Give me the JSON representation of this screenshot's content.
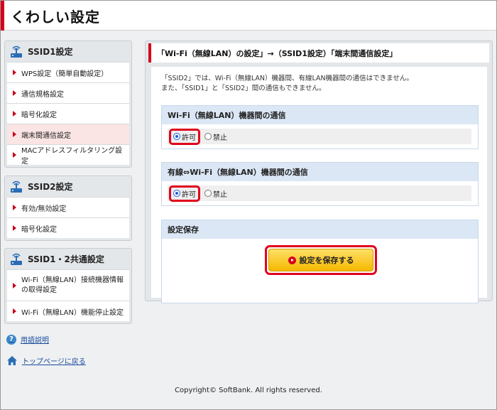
{
  "header": {
    "title": "くわしい設定"
  },
  "sidebar": {
    "groups": [
      {
        "title": "SSID1設定",
        "items": [
          {
            "label": "WPS設定（簡単自動設定）"
          },
          {
            "label": "通信規格設定"
          },
          {
            "label": "暗号化設定"
          },
          {
            "label": "端末間通信設定",
            "active": true
          },
          {
            "label": "MACアドレスフィルタリング設定"
          }
        ]
      },
      {
        "title": "SSID2設定",
        "items": [
          {
            "label": "有効/無効設定"
          },
          {
            "label": "暗号化設定"
          }
        ]
      },
      {
        "title": "SSID1・2共通設定",
        "items": [
          {
            "label_line1": "Wi-Fi（無線LAN）接続機器情報",
            "label_line2": "の取得設定"
          },
          {
            "label": "Wi-Fi（無線LAN）機能停止設定"
          }
        ]
      }
    ],
    "links": [
      {
        "label": "用語説明",
        "icon": "help-icon"
      },
      {
        "label": "トップページに戻る",
        "icon": "home-icon"
      }
    ]
  },
  "main": {
    "title": "「Wi-Fi（無線LAN）の設定」→（SSID1設定）「端末間通信設定」",
    "desc_line1": "「SSID2」では、Wi-Fi（無線LAN）機器間、有線LAN機器間の通信はできません。",
    "desc_line2": "また、「SSID1」と「SSID2」間の通信もできません。",
    "section1": {
      "title": "Wi-Fi（無線LAN）機器間の通信",
      "options": [
        "許可",
        "禁止"
      ],
      "selected": "許可"
    },
    "section2": {
      "title": "有線⇔Wi-Fi（無線LAN）機器間の通信",
      "options": [
        "許可",
        "禁止"
      ],
      "selected": "許可"
    },
    "save": {
      "title": "設定保存",
      "button_label": "設定を保存する"
    }
  },
  "footer": {
    "copyright": "Copyright© SoftBank. All rights reserved."
  },
  "colors": {
    "accent": "#d6001c",
    "highlight": "#e0001b",
    "button": "#f5b800",
    "section_head": "#dbe7f5"
  }
}
